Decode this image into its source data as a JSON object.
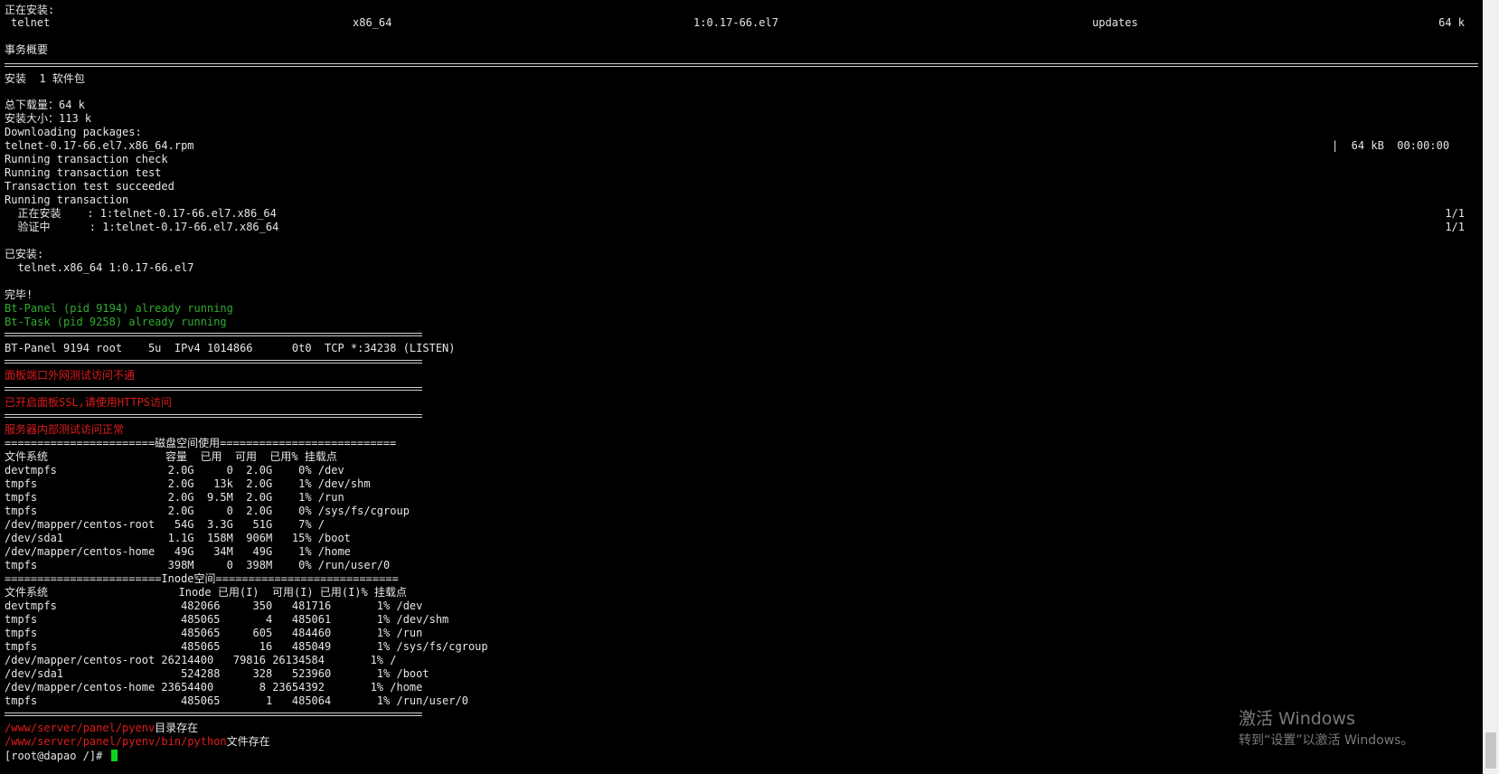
{
  "section_installing": "正在安装:",
  "install_row": {
    "name": "telnet",
    "arch": "x86_64",
    "version": "1:0.17-66.el7",
    "repo": "updates",
    "size": "64 k"
  },
  "summary_title": "事务概要",
  "summary_line": "安装  1 软件包",
  "total_download": "总下载量：64 k",
  "install_size": "安装大小：113 k",
  "downloading": "Downloading packages:",
  "rpm_name": "telnet-0.17-66.el7.x86_64.rpm",
  "rpm_progress": "|  64 kB  00:00:00",
  "tx_check": "Running transaction check",
  "tx_test": "Running transaction test",
  "tx_ok": "Transaction test succeeded",
  "tx_run": "Running transaction",
  "tx_install": "  正在安装    : 1:telnet-0.17-66.el7.x86_64",
  "tx_install_count": "1/1",
  "tx_verify": "  验证中      : 1:telnet-0.17-66.el7.x86_64",
  "tx_verify_count": "1/1",
  "installed_title": "已安装:",
  "installed_pkg": "  telnet.x86_64 1:0.17-66.el7",
  "done": "完毕!",
  "bt_panel": "Bt-Panel (pid 9194) already running",
  "bt_task": "Bt-Task (pid 9258) already running",
  "lsof_line": "BT-Panel 9194 root    5u  IPv4 1014866      0t0  TCP *:34238 (LISTEN)",
  "warn_external": "面板端口外网测试访问不通",
  "warn_ssl": "已开启面板SSL,请使用HTTPS访问",
  "msg_internal": "服务器内部测试访问正常",
  "disk_title": "=======================磁盘空间使用===========================",
  "disk_header": "文件系统                  容量  已用  可用  已用% 挂载点",
  "disk_rows": [
    "devtmpfs                 2.0G     0  2.0G    0% /dev",
    "tmpfs                    2.0G   13k  2.0G    1% /dev/shm",
    "tmpfs                    2.0G  9.5M  2.0G    1% /run",
    "tmpfs                    2.0G     0  2.0G    0% /sys/fs/cgroup",
    "/dev/mapper/centos-root   54G  3.3G   51G    7% /",
    "/dev/sda1                1.1G  158M  906M   15% /boot",
    "/dev/mapper/centos-home   49G   34M   49G    1% /home",
    "tmpfs                    398M     0  398M    0% /run/user/0"
  ],
  "inode_title": "========================Inode空间============================",
  "inode_header": "文件系统                    Inode 已用(I)  可用(I) 已用(I)% 挂载点",
  "inode_rows": [
    "devtmpfs                   482066     350   481716       1% /dev",
    "tmpfs                      485065       4   485061       1% /dev/shm",
    "tmpfs                      485065     605   484460       1% /run",
    "tmpfs                      485065      16   485049       1% /sys/fs/cgroup",
    "/dev/mapper/centos-root 26214400   79816 26134584       1% /",
    "/dev/sda1                  524288     328   523960       1% /boot",
    "/dev/mapper/centos-home 23654400       8 23654392       1% /home",
    "tmpfs                      485065       1   485064       1% /run/user/0"
  ],
  "pyenv_path": "/www/server/panel/pyenv",
  "pyenv_msg": "目录存在",
  "python_path": "/www/server/panel/pyenv/bin/python",
  "python_msg": "文件存在",
  "prompt": "[root@dapao /]# ",
  "watermark": {
    "title": "激活 Windows",
    "sub": "转到“设置”以激活 Windows。"
  },
  "colors": {
    "background": "#000000",
    "text": "#e6e6e6",
    "green": "#2fae2f",
    "red": "#e01b1b",
    "cursor": "#11d11d"
  }
}
